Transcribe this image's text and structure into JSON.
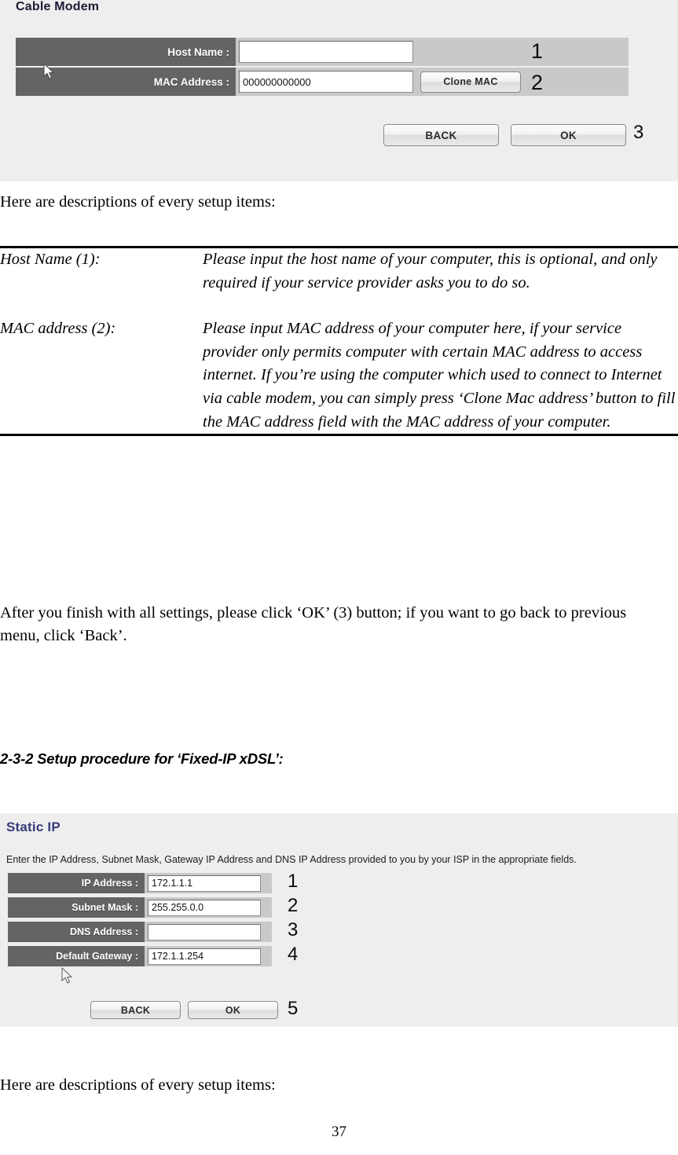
{
  "cable_modem_screenshot": {
    "title": "Cable Modem",
    "fields": [
      {
        "label": "Host Name :",
        "value": "",
        "callout": "1"
      },
      {
        "label": "MAC Address :",
        "value": "000000000000",
        "callout": "2"
      }
    ],
    "clone_button": "Clone MAC",
    "back_button": "BACK",
    "ok_button": "OK",
    "buttons_callout": "3"
  },
  "intro_line_1": "Here are descriptions of every setup items:",
  "descriptions": [
    {
      "term": "Host Name (1):",
      "definition": "Please input the host name of your computer, this is optional, and only required if your service provider asks you to do so."
    },
    {
      "term": "MAC address (2):",
      "definition": "Please input MAC address of your computer here, if your service provider only permits computer with certain MAC address to access internet. If you’re using the computer which used to connect to Internet via cable modem, you can simply press ‘Clone Mac address’ button to fill the MAC address field with the MAC address of your computer."
    }
  ],
  "closing_paragraph": "After you finish with all settings, please click ‘OK’ (3) button; if you want to go back to previous menu, click ‘Back’.",
  "section_heading": "2-3-2 Setup procedure for ‘Fixed-IP xDSL’:",
  "static_ip_screenshot": {
    "title": "Static IP",
    "hint": "Enter the IP Address, Subnet Mask, Gateway IP Address and DNS IP Address provided to you by your ISP in the appropriate fields.",
    "fields": [
      {
        "label": "IP Address :",
        "value": "172.1.1.1",
        "callout": "1"
      },
      {
        "label": "Subnet Mask :",
        "value": "255.255.0.0",
        "callout": "2"
      },
      {
        "label": "DNS Address :",
        "value": "",
        "callout": "3"
      },
      {
        "label": "Default Gateway :",
        "value": "172.1.1.254",
        "callout": "4"
      }
    ],
    "back_button": "BACK",
    "ok_button": "OK",
    "buttons_callout": "5"
  },
  "intro_line_2": "Here are descriptions of every setup items:",
  "page_number": "37",
  "colors": {
    "panel_background": "#eeeeee",
    "label_background": "#646464",
    "row_background": "#c9c9c9",
    "static_ip_title": "#363b7a",
    "cable_modem_title": "#1b1b33"
  }
}
